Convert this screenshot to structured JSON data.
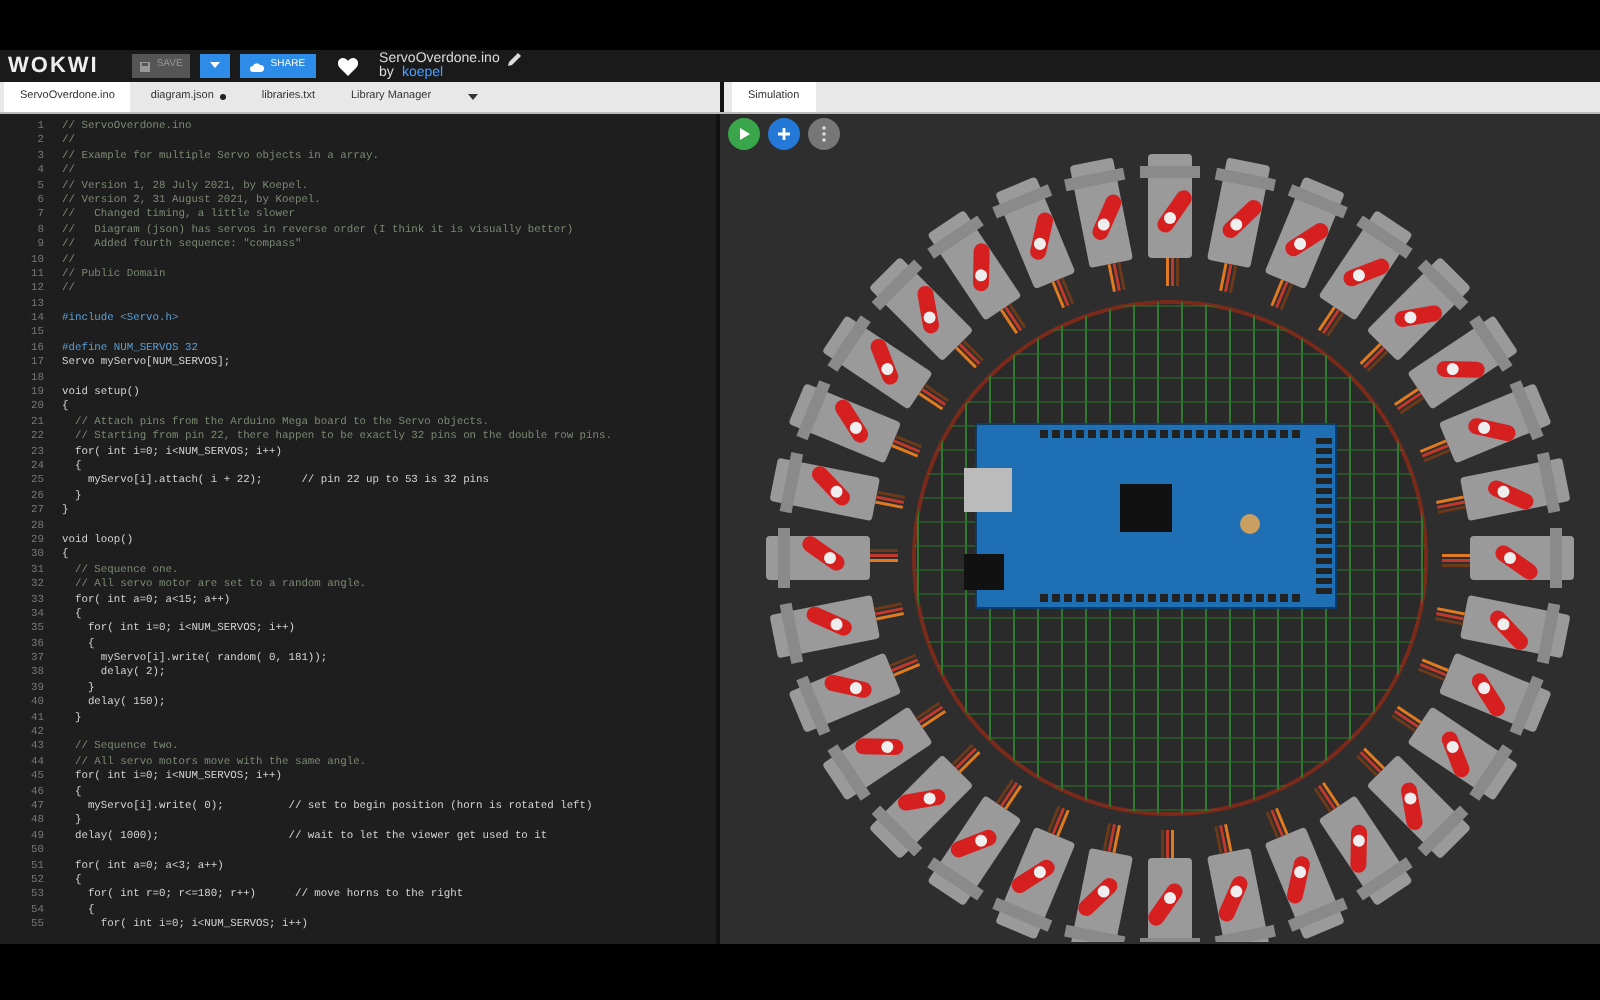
{
  "header": {
    "logo": "WOKWI",
    "save_button": "SAVE",
    "share_button": "SHARE",
    "project_title": "ServoOverdone.ino",
    "byline": "by",
    "author": "koepel"
  },
  "editor_tabs": [
    {
      "label": "ServoOverdone.ino",
      "selected": true,
      "modified": false
    },
    {
      "label": "diagram.json",
      "selected": false,
      "modified": true
    },
    {
      "label": "libraries.txt",
      "selected": false,
      "modified": false
    },
    {
      "label": "Library Manager",
      "selected": false,
      "modified": false
    }
  ],
  "simulation_tab": {
    "label": "Simulation",
    "selected": true
  },
  "code_lines": [
    {
      "number": "1",
      "kind": "comment",
      "text": "// ServoOverdone.ino"
    },
    {
      "number": "2",
      "kind": "comment",
      "text": "//"
    },
    {
      "number": "3",
      "kind": "comment",
      "text": "// Example for multiple Servo objects in a array."
    },
    {
      "number": "4",
      "kind": "comment",
      "text": "//"
    },
    {
      "number": "5",
      "kind": "comment",
      "text": "// Version 1, 28 July 2021, by Koepel."
    },
    {
      "number": "6",
      "kind": "comment",
      "text": "// Version 2, 31 August 2021, by Koepel."
    },
    {
      "number": "7",
      "kind": "comment",
      "text": "//   Changed timing, a little slower"
    },
    {
      "number": "8",
      "kind": "comment",
      "text": "//   Diagram (json) has servos in reverse order (I think it is visually better)"
    },
    {
      "number": "9",
      "kind": "comment",
      "text": "//   Added fourth sequence: \"compass\""
    },
    {
      "number": "10",
      "kind": "comment",
      "text": "//"
    },
    {
      "number": "11",
      "kind": "comment",
      "text": "// Public Domain"
    },
    {
      "number": "12",
      "kind": "comment",
      "text": "//"
    },
    {
      "number": "13",
      "kind": "blank"
    },
    {
      "number": "14",
      "kind": "directive",
      "text": "#include <Servo.h>"
    },
    {
      "number": "15",
      "kind": "blank"
    },
    {
      "number": "16",
      "kind": "directive",
      "text": "#define NUM_SERVOS 32"
    },
    {
      "number": "17",
      "kind": "code",
      "text": "Servo myServo[NUM_SERVOS];"
    },
    {
      "number": "18",
      "kind": "blank"
    },
    {
      "number": "19",
      "kind": "code",
      "text": "void setup()"
    },
    {
      "number": "20",
      "kind": "code",
      "text": "{"
    },
    {
      "number": "21",
      "kind": "comment",
      "text": "  // Attach pins from the Arduino Mega board to the Servo objects."
    },
    {
      "number": "22",
      "kind": "comment",
      "text": "  // Starting from pin 22, there happen to be exactly 32 pins on the double row pins."
    },
    {
      "number": "23",
      "kind": "code",
      "text": "  for( int i=0; i<NUM_SERVOS; i++)"
    },
    {
      "number": "24",
      "kind": "code",
      "text": "  {"
    },
    {
      "number": "25",
      "kind": "code",
      "text": "    myServo[i].attach( i + 22);      // pin 22 up to 53 is 32 pins"
    },
    {
      "number": "26",
      "kind": "code",
      "text": "  }"
    },
    {
      "number": "27",
      "kind": "code",
      "text": "}"
    },
    {
      "number": "28",
      "kind": "blank"
    },
    {
      "number": "29",
      "kind": "code",
      "text": "void loop()"
    },
    {
      "number": "30",
      "kind": "code",
      "text": "{"
    },
    {
      "number": "31",
      "kind": "comment",
      "text": "  // Sequence one."
    },
    {
      "number": "32",
      "kind": "comment",
      "text": "  // All servo motor are set to a random angle."
    },
    {
      "number": "33",
      "kind": "code",
      "text": "  for( int a=0; a<15; a++)"
    },
    {
      "number": "34",
      "kind": "code",
      "text": "  {"
    },
    {
      "number": "35",
      "kind": "code",
      "text": "    for( int i=0; i<NUM_SERVOS; i++)"
    },
    {
      "number": "36",
      "kind": "code",
      "text": "    {"
    },
    {
      "number": "37",
      "kind": "code",
      "text": "      myServo[i].write( random( 0, 181));"
    },
    {
      "number": "38",
      "kind": "code",
      "text": "      delay( 2);"
    },
    {
      "number": "39",
      "kind": "code",
      "text": "    }"
    },
    {
      "number": "40",
      "kind": "code",
      "text": "    delay( 150);"
    },
    {
      "number": "41",
      "kind": "code",
      "text": "  }"
    },
    {
      "number": "42",
      "kind": "blank"
    },
    {
      "number": "43",
      "kind": "comment",
      "text": "  // Sequence two."
    },
    {
      "number": "44",
      "kind": "comment",
      "text": "  // All servo motors move with the same angle."
    },
    {
      "number": "45",
      "kind": "code",
      "text": "  for( int i=0; i<NUM_SERVOS; i++)"
    },
    {
      "number": "46",
      "kind": "code",
      "text": "  {"
    },
    {
      "number": "47",
      "kind": "code",
      "text": "    myServo[i].write( 0);          // set to begin position (horn is rotated left)"
    },
    {
      "number": "48",
      "kind": "code",
      "text": "  }"
    },
    {
      "number": "49",
      "kind": "code",
      "text": "  delay( 1000);                    // wait to let the viewer get used to it"
    },
    {
      "number": "50",
      "kind": "blank"
    },
    {
      "number": "51",
      "kind": "code",
      "text": "  for( int a=0; a<3; a++)"
    },
    {
      "number": "52",
      "kind": "code",
      "text": "  {"
    },
    {
      "number": "53",
      "kind": "code",
      "text": "    for( int r=0; r<=180; r++)      // move horns to the right"
    },
    {
      "number": "54",
      "kind": "code",
      "text": "    {"
    },
    {
      "number": "55",
      "kind": "code",
      "text": "      for( int i=0; i<NUM_SERVOS; i++)"
    }
  ]
}
